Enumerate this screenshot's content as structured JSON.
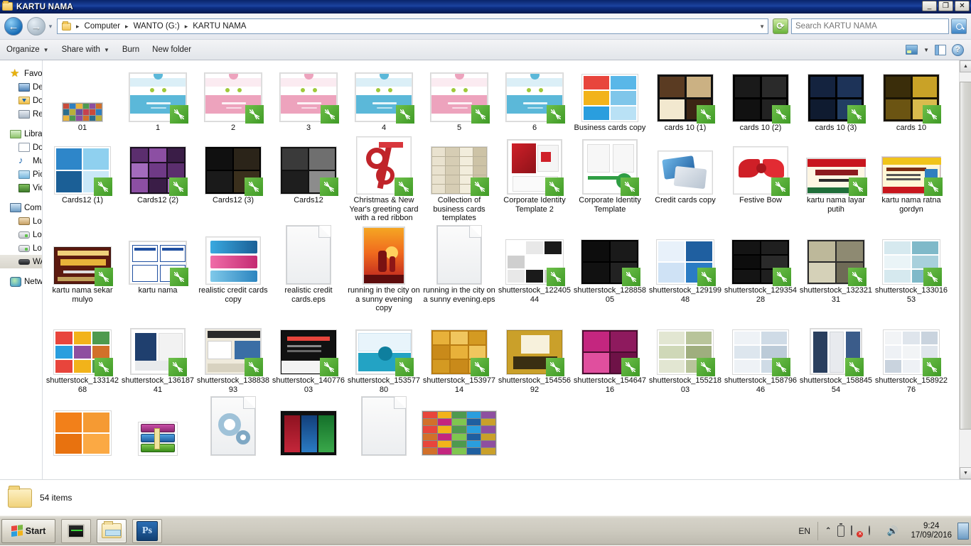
{
  "window": {
    "title": "KARTU NAMA",
    "icon": "folder-icon",
    "buttons": {
      "minimize": "_",
      "maximize": "❐",
      "close": "✕"
    }
  },
  "addressbar": {
    "back_icon": "back-arrow-icon",
    "forward_icon": "forward-arrow-icon",
    "history_icon": "history-dropdown-icon",
    "crumbs": [
      "Computer",
      "WANTO (G:)",
      "KARTU NAMA"
    ],
    "separator": "▸",
    "dropdown_caret": "▼",
    "refresh_icon": "refresh-icon",
    "refresh_glyph": "⟳"
  },
  "search": {
    "placeholder": "Search KARTU NAMA",
    "value": "",
    "button_icon": "search-icon"
  },
  "commandbar": {
    "organize": "Organize",
    "share_with": "Share with",
    "burn": "Burn",
    "new_folder": "New folder",
    "caret": "▼",
    "preview_icon": "preview-pane-icon",
    "view_caret": "▼",
    "panes_icon": "layout-pane-icon",
    "help_icon": "help-icon",
    "help_glyph": "?"
  },
  "navpane": {
    "groups": [
      {
        "header": {
          "label": "Favorites",
          "icon": "star-icon",
          "ico": "ico-star",
          "glyph": "★"
        },
        "items": [
          {
            "label": "Desktop",
            "icon": "desktop-icon",
            "ico": "ico-desktop"
          },
          {
            "label": "Downloads",
            "icon": "downloads-icon",
            "ico": "ico-dl"
          },
          {
            "label": "Recent Places",
            "icon": "recent-places-icon",
            "ico": "ico-recent"
          }
        ]
      },
      {
        "header": {
          "label": "Libraries",
          "icon": "libraries-icon",
          "ico": "ico-lib"
        },
        "items": [
          {
            "label": "Documents",
            "icon": "documents-icon",
            "ico": "ico-doc"
          },
          {
            "label": "Music",
            "icon": "music-icon",
            "ico": "ico-music",
            "glyph": "♪"
          },
          {
            "label": "Pictures",
            "icon": "pictures-icon",
            "ico": "ico-pic"
          },
          {
            "label": "Videos",
            "icon": "videos-icon",
            "ico": "ico-vid"
          }
        ]
      },
      {
        "header": {
          "label": "Computer",
          "icon": "computer-icon",
          "ico": "ico-comp"
        },
        "items": [
          {
            "label": "Local Disk (C:)",
            "icon": "local-disk-c-icon",
            "ico": "ico-hdd"
          },
          {
            "label": "Local Disk (D:)",
            "icon": "local-disk-d-icon",
            "ico": "ico-drv"
          },
          {
            "label": "Local Disk (E:)",
            "icon": "local-disk-e-icon",
            "ico": "ico-drv"
          },
          {
            "label": "WANTO (G:)",
            "icon": "removable-drive-icon",
            "ico": "ico-usb",
            "selected": true
          }
        ]
      },
      {
        "header": {
          "label": "Network",
          "icon": "network-icon",
          "ico": "ico-net"
        },
        "items": []
      }
    ]
  },
  "files": {
    "items": [
      {
        "name": "01",
        "thumb": "collage",
        "badge": false
      },
      {
        "name": "1",
        "thumb": "card-blue",
        "badge": true
      },
      {
        "name": "2",
        "thumb": "card-pink",
        "badge": true
      },
      {
        "name": "3",
        "thumb": "card-pink",
        "badge": true
      },
      {
        "name": "4",
        "thumb": "card-blue",
        "badge": true
      },
      {
        "name": "5",
        "thumb": "card-pink",
        "badge": true
      },
      {
        "name": "6",
        "thumb": "card-blue",
        "badge": true
      },
      {
        "name": "Business cards copy",
        "thumb": "grid-bright",
        "badge": false
      },
      {
        "name": "cards 10 (1)",
        "thumb": "grid-brown",
        "badge": true
      },
      {
        "name": "cards 10 (2)",
        "thumb": "grid-dark",
        "badge": true
      },
      {
        "name": "cards 10 (3)",
        "thumb": "grid-navy",
        "badge": true
      },
      {
        "name": "cards 10",
        "thumb": "grid-gold",
        "badge": true
      },
      {
        "name": "Cards12 (1)",
        "thumb": "grid-sky",
        "badge": true
      },
      {
        "name": "Cards12 (2)",
        "thumb": "grid-purple",
        "badge": true
      },
      {
        "name": "Cards12 (3)",
        "thumb": "grid-black",
        "badge": true
      },
      {
        "name": "Cards12",
        "thumb": "grid-gray",
        "badge": true
      },
      {
        "name": "Christmas & New Year's greeting card with a red ribbon",
        "thumb": "ribbon",
        "badge": true
      },
      {
        "name": "Collection of business cards templates",
        "thumb": "grid-beige",
        "badge": true
      },
      {
        "name": "Corporate Identity Template 2",
        "thumb": "ci-red",
        "badge": true
      },
      {
        "name": "Corporate Identity Template",
        "thumb": "ci-green",
        "badge": true
      },
      {
        "name": "Credit cards copy",
        "thumb": "credit",
        "badge": false
      },
      {
        "name": "Festive Bow",
        "thumb": "bow",
        "badge": true
      },
      {
        "name": "kartu nama layar putih",
        "thumb": "warung",
        "badge": true
      },
      {
        "name": "kartu nama ratna gordyn",
        "thumb": "ratna",
        "badge": true
      },
      {
        "name": "kartu nama sekar mulyo",
        "thumb": "sekar",
        "badge": true
      },
      {
        "name": "kartu nama",
        "thumb": "bluecards",
        "badge": true
      },
      {
        "name": "realistic credit cards copy",
        "thumb": "realistic",
        "badge": false
      },
      {
        "name": "realistic credit cards.eps",
        "thumb": "page",
        "badge": false
      },
      {
        "name": "running in the city on a sunny evening copy",
        "thumb": "runner",
        "badge": false
      },
      {
        "name": "running in the city on a sunny evening.eps",
        "thumb": "page",
        "badge": false
      },
      {
        "name": "shutterstock_12240544",
        "thumb": "ss-mono",
        "badge": true
      },
      {
        "name": "shutterstock_12885805",
        "thumb": "ss-black",
        "badge": true
      },
      {
        "name": "shutterstock_12919948",
        "thumb": "ss-blue",
        "badge": true
      },
      {
        "name": "shutterstock_12935428",
        "thumb": "ss-dark",
        "badge": true
      },
      {
        "name": "shutterstock_13232131",
        "thumb": "ss-chalk",
        "badge": true
      },
      {
        "name": "shutterstock_13301653",
        "thumb": "ss-teal",
        "badge": true
      },
      {
        "name": "shutterstock_13314268",
        "thumb": "ss-multi",
        "badge": true
      },
      {
        "name": "shutterstock_13618741",
        "thumb": "ss-navyid",
        "badge": true
      },
      {
        "name": "shutterstock_13883893",
        "thumb": "ss-letter",
        "badge": true
      },
      {
        "name": "shutterstock_14077603",
        "thumb": "ss-yourtext",
        "badge": true
      },
      {
        "name": "shutterstock_15357780",
        "thumb": "ss-cyan",
        "badge": true
      },
      {
        "name": "shutterstock_15397714",
        "thumb": "ss-orange",
        "badge": true
      },
      {
        "name": "shutterstock_15455692",
        "thumb": "ss-mustard",
        "badge": true
      },
      {
        "name": "shutterstock_15464716",
        "thumb": "ss-magenta",
        "badge": true
      },
      {
        "name": "shutterstock_15521803",
        "thumb": "ss-sage",
        "badge": true
      },
      {
        "name": "shutterstock_15879646",
        "thumb": "ss-pale",
        "badge": true
      },
      {
        "name": "shutterstock_15884554",
        "thumb": "ss-bars",
        "badge": true
      },
      {
        "name": "shutterstock_15892276",
        "thumb": "ss-lite",
        "badge": true
      },
      {
        "name": "",
        "thumb": "orange4",
        "badge": false
      },
      {
        "name": "",
        "thumb": "winrar",
        "badge": false
      },
      {
        "name": "",
        "thumb": "gears",
        "badge": false
      },
      {
        "name": "",
        "thumb": "rgbcards",
        "badge": false
      },
      {
        "name": "",
        "thumb": "page",
        "badge": false
      },
      {
        "name": "",
        "thumb": "bigmulti",
        "badge": false
      }
    ]
  },
  "statusbar": {
    "icon": "folder-icon",
    "text": "54 items"
  },
  "taskbar": {
    "start_label": "Start",
    "start_icon": "windows-logo-icon",
    "items": [
      {
        "icon": "system-monitor-icon",
        "active": false
      },
      {
        "icon": "explorer-folder-icon",
        "active": true
      },
      {
        "icon": "photoshop-icon",
        "label": "Ps",
        "active": false
      }
    ],
    "tray": {
      "language": "EN",
      "chevron": "⌃",
      "icons": [
        "show-hidden-icons",
        "battery-icon",
        "network-error-icon",
        "action-center-icon",
        "volume-icon"
      ],
      "time": "9:24",
      "date": "17/09/2016",
      "show_desktop": "show-desktop-button"
    }
  },
  "scrollbar": {
    "up_arrow": "▲",
    "down_arrow": "▼"
  }
}
